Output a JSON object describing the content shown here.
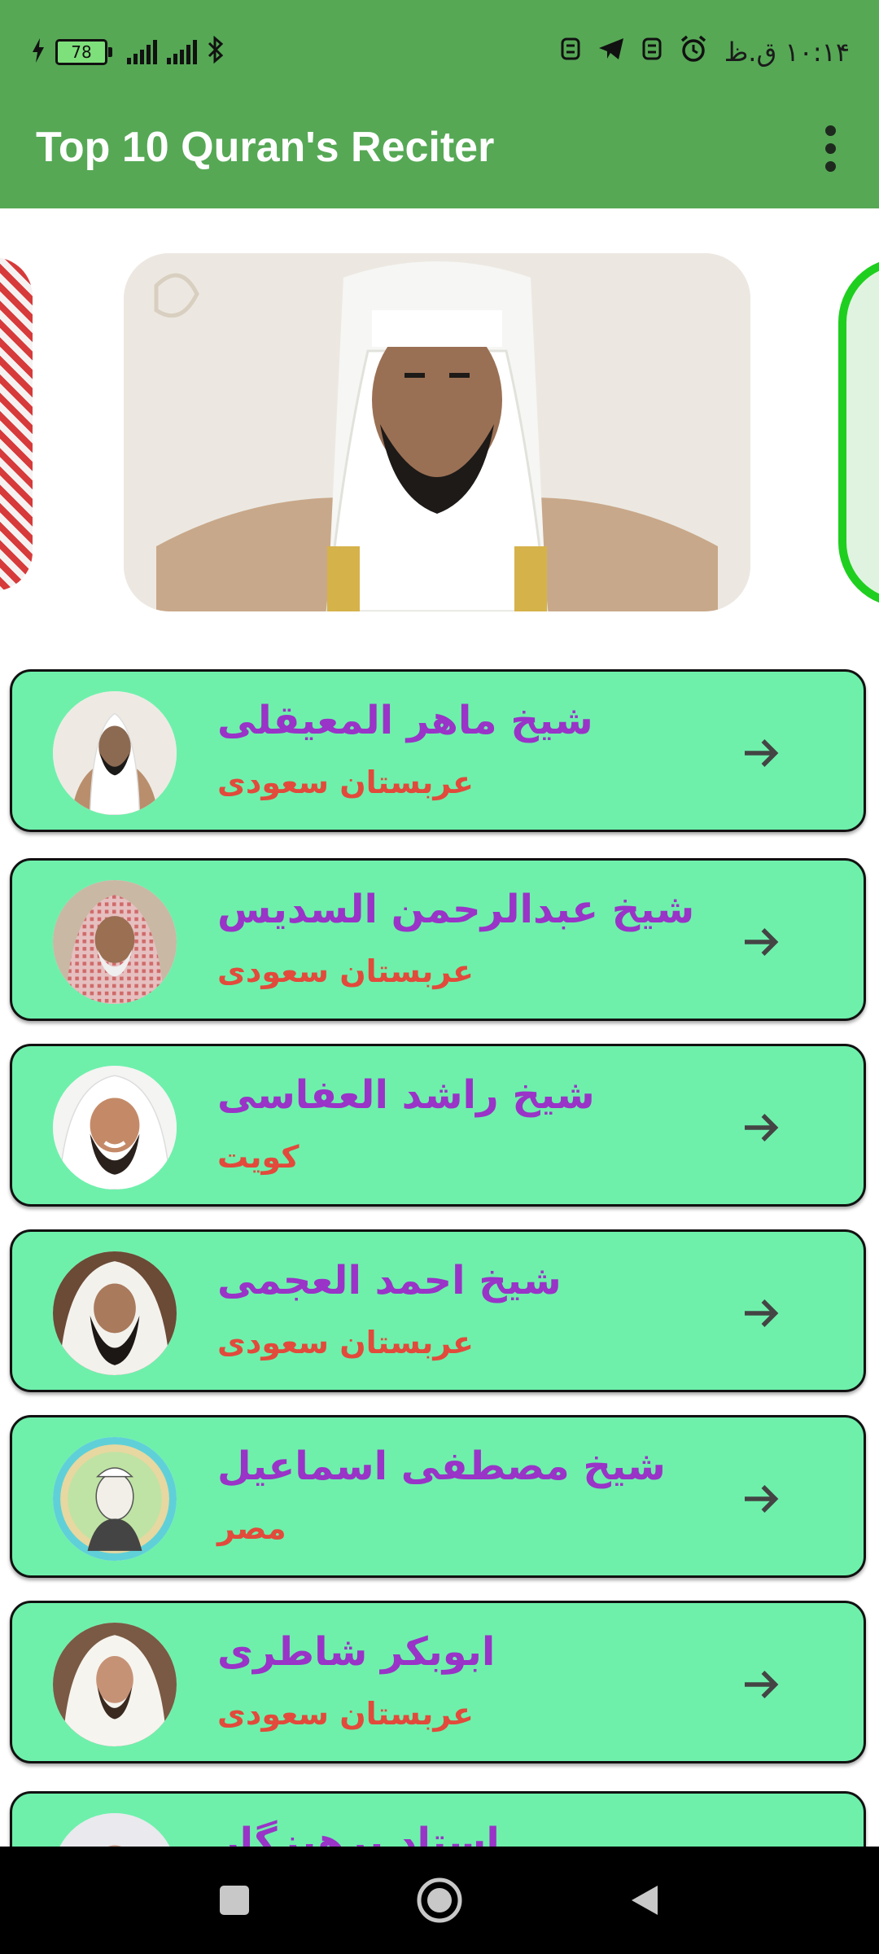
{
  "status_bar": {
    "battery": "78",
    "time": "۱۰:۱۴ ق.ظ",
    "icons": [
      "charging-icon",
      "battery-icon",
      "signal-icon",
      "signal-icon",
      "bluetooth-icon",
      "vpn-icon",
      "telegram-icon",
      "vpn-icon",
      "alarm-icon"
    ]
  },
  "app_bar": {
    "title": "Top 10 Quran's Reciter",
    "menu_icon": "more-vert-icon"
  },
  "carousel": {
    "slides": [
      "reciter-photo-left",
      "reciter-photo-maher",
      "reciter-photo-right"
    ]
  },
  "reciters": [
    {
      "name": "شیخ ماهر المعیقلی",
      "country": "عربستان سعودی"
    },
    {
      "name": "شیخ عبدالرحمن السدیس",
      "country": "عربستان سعودی"
    },
    {
      "name": "شیخ راشد العفاسی",
      "country": "کویت"
    },
    {
      "name": "شیخ احمد العجمی",
      "country": "عربستان سعودی"
    },
    {
      "name": "شیخ مصطفی اسماعیل",
      "country": "مصر"
    },
    {
      "name": "ابوبکر شاطری",
      "country": "عربستان سعودی"
    },
    {
      "name": "استاد پرهیزگار",
      "country": ""
    }
  ],
  "colors": {
    "app_bar": "#56a855",
    "card": "#6ef0ab",
    "name": "#9a33c7",
    "country": "#e24a3b"
  },
  "nav": {
    "icons": [
      "recent-apps-icon",
      "home-icon",
      "back-icon"
    ]
  }
}
